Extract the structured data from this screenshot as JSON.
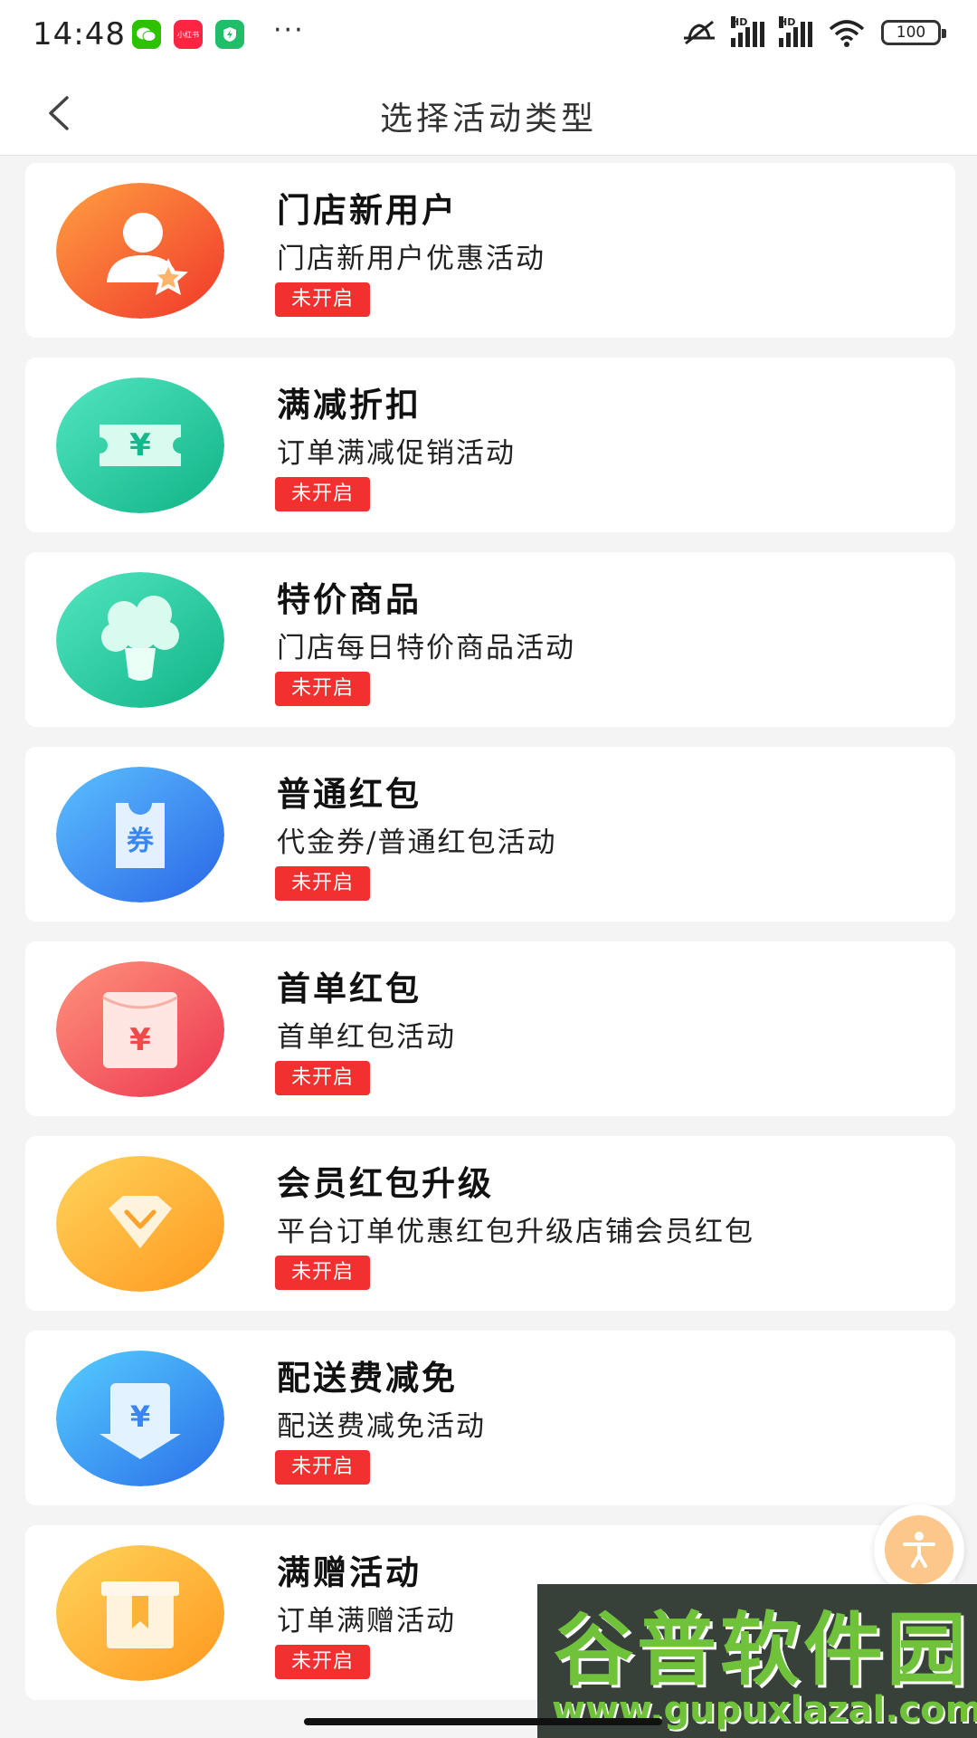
{
  "status_bar": {
    "time": "14:48",
    "app_icons": [
      {
        "name": "wechat-icon",
        "color": "#2dc100"
      },
      {
        "name": "xiaohongshu-icon",
        "color": "#ff2442",
        "label": "小红书"
      },
      {
        "name": "security-app-icon",
        "color": "#1fbf6a"
      }
    ],
    "more": "···",
    "signal_label": "HD",
    "battery": "100"
  },
  "nav": {
    "back_icon": "chevron-left-icon",
    "title": "选择活动类型"
  },
  "activities": [
    {
      "title": "门店新用户",
      "desc": "门店新用户优惠活动",
      "status": "未开启",
      "icon": "new-user-icon",
      "colors": [
        "#ff9a3c",
        "#f23d2b"
      ]
    },
    {
      "title": "满减折扣",
      "desc": "订单满减促销活动",
      "status": "未开启",
      "icon": "discount-ticket-icon",
      "colors": [
        "#4be3bd",
        "#13b98c"
      ]
    },
    {
      "title": "特价商品",
      "desc": "门店每日特价商品活动",
      "status": "未开启",
      "icon": "cabbage-icon",
      "colors": [
        "#4be3bd",
        "#13b98c"
      ]
    },
    {
      "title": "普通红包",
      "desc": "代金券/普通红包活动",
      "status": "未开启",
      "icon": "coupon-icon",
      "colors": [
        "#52b6ff",
        "#2c6ee8"
      ]
    },
    {
      "title": "首单红包",
      "desc": "首单红包活动",
      "status": "未开启",
      "icon": "red-envelope-icon",
      "colors": [
        "#ff8c7a",
        "#ef3c4f"
      ]
    },
    {
      "title": "会员红包升级",
      "desc": "平台订单优惠红包升级店铺会员红包",
      "status": "未开启",
      "icon": "diamond-icon",
      "colors": [
        "#ffd25a",
        "#ff9b1f"
      ]
    },
    {
      "title": "配送费减免",
      "desc": "配送费减免活动",
      "status": "未开启",
      "icon": "delivery-fee-icon",
      "colors": [
        "#52c8ff",
        "#2a73ea"
      ]
    },
    {
      "title": "满赠活动",
      "desc": "订单满赠活动",
      "status": "未开启",
      "icon": "gift-box-icon",
      "colors": [
        "#ffd25a",
        "#ff9b1f"
      ]
    }
  ],
  "icon_glyphs": {
    "yuan": "¥",
    "coupon": "券"
  },
  "floating_button": {
    "icon": "accessibility-icon",
    "color": "#fbc78a"
  },
  "watermark": {
    "name": "谷普软件园",
    "url": "www.gupuxlazal.com"
  },
  "colors": {
    "status_badge": "#f2302f",
    "background": "#f4f4f4"
  }
}
